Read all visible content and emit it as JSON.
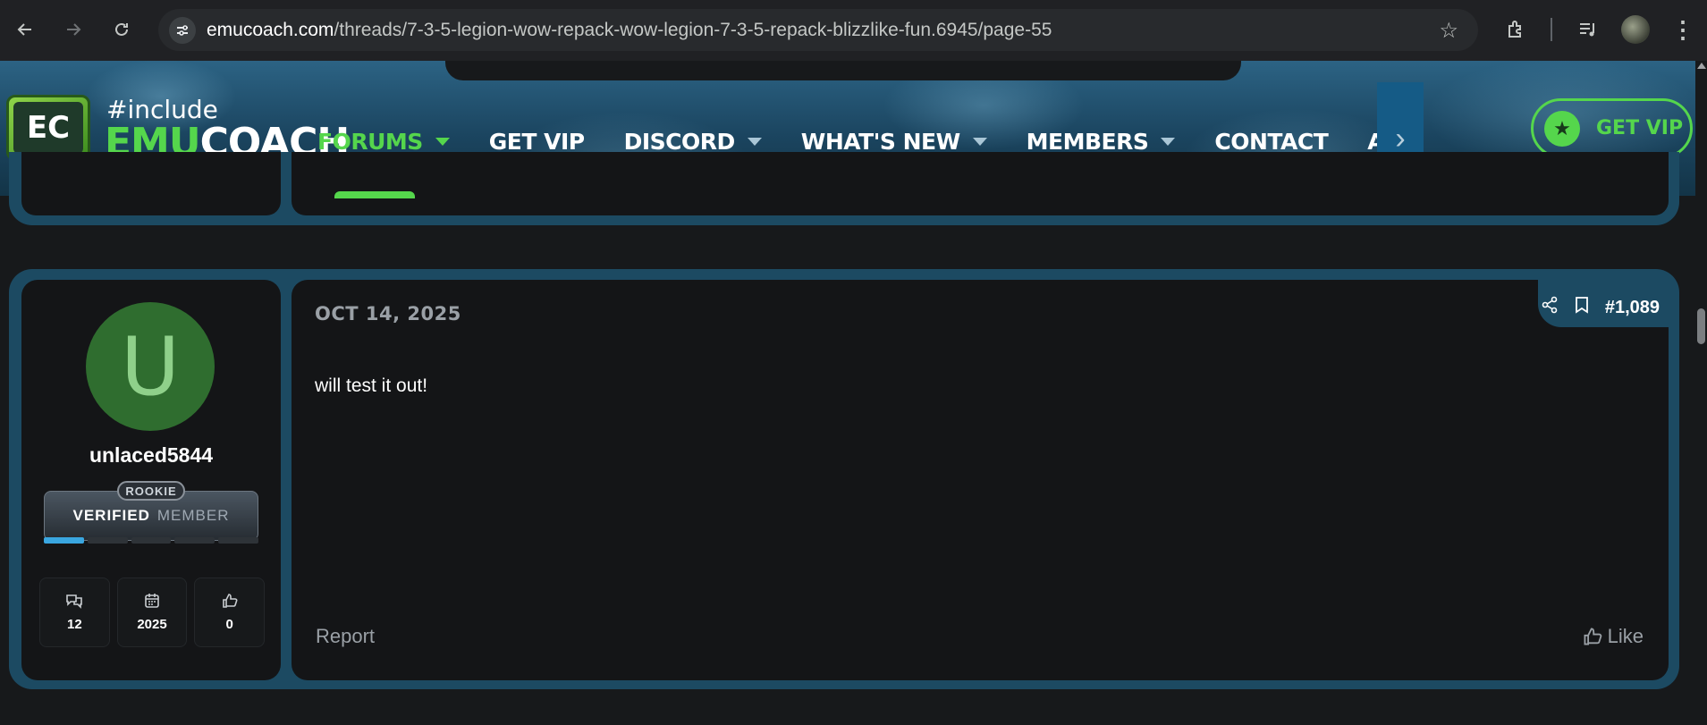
{
  "browser": {
    "url_host": "emucoach.com",
    "url_path": "/threads/7-3-5-legion-wow-repack-wow-legion-7-3-5-repack-blizzlike-fun.6945/page-55"
  },
  "site": {
    "logo_letters": "EC",
    "tagline": "#include",
    "brand_emu": "EMU",
    "brand_coach": "COACH",
    "nav": [
      {
        "label": "FORUMS",
        "dropdown": true,
        "active": true
      },
      {
        "label": "GET VIP",
        "dropdown": false,
        "active": false
      },
      {
        "label": "DISCORD",
        "dropdown": true,
        "active": false
      },
      {
        "label": "WHAT'S NEW",
        "dropdown": true,
        "active": false
      },
      {
        "label": "MEMBERS",
        "dropdown": true,
        "active": false
      },
      {
        "label": "CONTACT",
        "dropdown": false,
        "active": false
      },
      {
        "label": "ACCOUNT T",
        "dropdown": false,
        "active": false
      }
    ],
    "vip_button": "GET VIP",
    "accent_color": "#55d64c"
  },
  "post": {
    "avatar_letter": "U",
    "username": "unlaced5844",
    "rank_tag": "ROOKIE",
    "rank_title_strong": "VERIFIED",
    "rank_title_light": "MEMBER",
    "stats": {
      "messages": "12",
      "joined": "2025",
      "reactions": "0"
    },
    "date": "OCT 14, 2025",
    "number": "#1,089",
    "body": "will test it out!",
    "report_label": "Report",
    "like_label": "Like"
  }
}
